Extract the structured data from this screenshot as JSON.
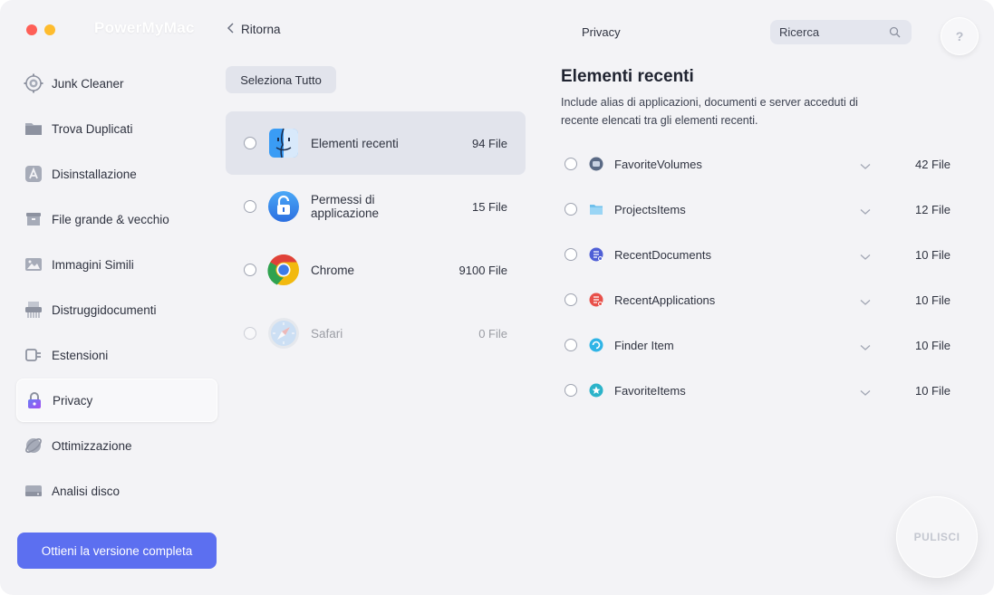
{
  "app": {
    "title": "PowerMyMac"
  },
  "topbar": {
    "back_label": "Ritorna",
    "section_title": "Privacy",
    "search_placeholder": "Ricerca",
    "help_label": "?"
  },
  "sidebar": {
    "items": [
      {
        "label": "Junk Cleaner",
        "icon": "gear-target-icon"
      },
      {
        "label": "Trova Duplicati",
        "icon": "folder-icon"
      },
      {
        "label": "Disinstallazione",
        "icon": "app-store-icon"
      },
      {
        "label": "File grande & vecchio",
        "icon": "archive-box-icon"
      },
      {
        "label": "Immagini Simili",
        "icon": "photo-icon"
      },
      {
        "label": "Distruggidocumenti",
        "icon": "shredder-icon"
      },
      {
        "label": "Estensioni",
        "icon": "plug-icon"
      },
      {
        "label": "Privacy",
        "icon": "lock-icon",
        "active": true
      },
      {
        "label": "Ottimizzazione",
        "icon": "optimize-icon"
      },
      {
        "label": "Analisi disco",
        "icon": "disk-icon"
      }
    ],
    "cta_label": "Ottieni la versione completa"
  },
  "browsers": {
    "select_all_label": "Seleziona Tutto",
    "items": [
      {
        "name": "Elementi recenti",
        "count": "94 File",
        "icon": "finder-icon",
        "active": true
      },
      {
        "name": "Permessi di applicazione",
        "count": "15 File",
        "icon": "unlock-icon"
      },
      {
        "name": "Chrome",
        "count": "9100 File",
        "icon": "chrome-icon"
      },
      {
        "name": "Safari",
        "count": "0 File",
        "icon": "safari-icon",
        "disabled": true
      }
    ]
  },
  "detail": {
    "title": "Elementi recenti",
    "description": "Include alias di applicazioni, documenti e server acceduti di recente elencati tra gli elementi recenti.",
    "items": [
      {
        "name": "FavoriteVolumes",
        "count": "42 File",
        "icon": "volume-icon"
      },
      {
        "name": "ProjectsItems",
        "count": "12 File",
        "icon": "folder-icon"
      },
      {
        "name": "RecentDocuments",
        "count": "10 File",
        "icon": "document-icon"
      },
      {
        "name": "RecentApplications",
        "count": "10 File",
        "icon": "application-icon"
      },
      {
        "name": "Finder Item",
        "count": "10 File",
        "icon": "finder-item-icon"
      },
      {
        "name": "FavoriteItems",
        "count": "10 File",
        "icon": "star-icon"
      }
    ],
    "clean_label": "PULISCI"
  },
  "colors": {
    "accent": "#5c6ff0",
    "window_bg": "#f3f3f6",
    "selection_bg": "#e2e4ec",
    "close": "#fe5f57",
    "minimize": "#febc2e"
  }
}
